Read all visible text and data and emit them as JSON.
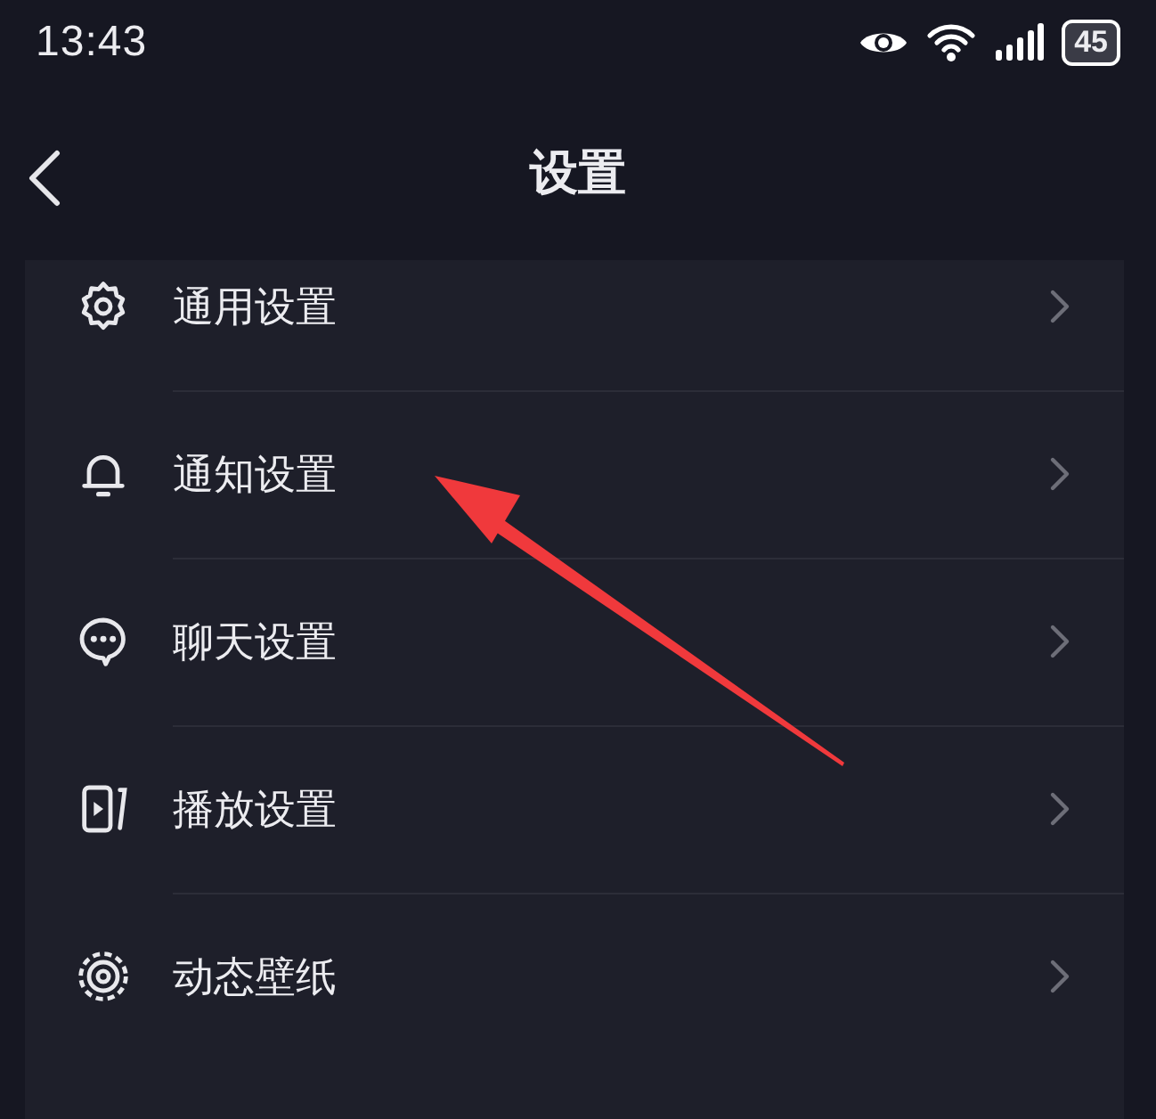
{
  "status_bar": {
    "time": "13:43",
    "battery": "45"
  },
  "nav": {
    "title": "设置"
  },
  "items": [
    {
      "kind": "gear",
      "label": "通用设置"
    },
    {
      "kind": "bell",
      "label": "通知设置"
    },
    {
      "kind": "chat",
      "label": "聊天设置"
    },
    {
      "kind": "play",
      "label": "播放设置"
    },
    {
      "kind": "wallpaper",
      "label": "动态壁纸"
    }
  ]
}
